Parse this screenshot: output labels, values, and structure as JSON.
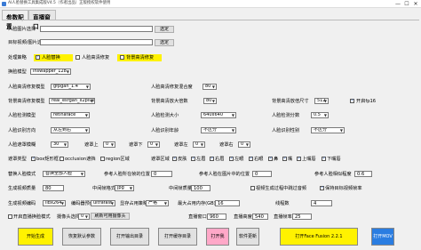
{
  "window": {
    "title": "AI人脸替换工具集成版V4.5（作者出品）正版授权软件使用",
    "min": "—",
    "max": "☐",
    "close": "✕"
  },
  "tabs": [
    "参数配置",
    "直播窗口"
  ],
  "face_image": {
    "label": "人脸图片选择",
    "value": "",
    "button": "选定"
  },
  "target": {
    "label": "目标视频/图片选择",
    "value": "",
    "button": "选定"
  },
  "strategy": {
    "label": "处理策略",
    "options": [
      {
        "label": "人脸替换",
        "checked": true
      },
      {
        "label": "人脸高清修复",
        "checked": false
      },
      {
        "label": "背景高清修复",
        "checked": false
      }
    ]
  },
  "swap_model": {
    "label": "换脸模型",
    "value": "inswapper_128"
  },
  "face_enhance_model": {
    "label": "人脸高清修复模型",
    "value": "gfpgan_1.4"
  },
  "face_enhance_blend": {
    "label": "人脸高清修复混合度",
    "value": "80"
  },
  "bg_enhance_model": {
    "label": "背景高清修复模型",
    "value": "real_esrgan_x2plus"
  },
  "bg_enhance_scale": {
    "label": "背景高清放大倍数",
    "value": "80"
  },
  "bg_enhance_size": {
    "label": "背景高清放倍尺寸",
    "value": "512"
  },
  "fp16": {
    "label": "开启fp16",
    "checked": true
  },
  "face_detect_model": {
    "label": "人脸检测模型",
    "value": "retinaface"
  },
  "face_detect_size": {
    "label": "人脸检测大小",
    "value": "640x640"
  },
  "face_detect_score": {
    "label": "人脸检测分数",
    "value": "0.5"
  },
  "face_detect_order": {
    "label": "人脸识别方向",
    "value": "从左到右"
  },
  "face_age": {
    "label": "人脸识别年龄",
    "value": "不区分"
  },
  "face_gender": {
    "label": "人脸识别性别",
    "value": "不区分"
  },
  "face_blur": {
    "label": "人脸遮罩模糊",
    "value": "30"
  },
  "mask_top": {
    "label": "遮罩上",
    "value": "0"
  },
  "mask_bottom": {
    "label": "遮罩下",
    "value": "0"
  },
  "mask_left": {
    "label": "遮罩左",
    "value": "0"
  },
  "mask_right": {
    "label": "遮罩右",
    "value": "0"
  },
  "mask_types": {
    "label": "遮罩类型",
    "options": [
      {
        "label": "box矩形框",
        "checked": true
      },
      {
        "label": "occlusion遮挡",
        "checked": false
      },
      {
        "label": "region区域",
        "checked": false
      }
    ]
  },
  "mask_regions": {
    "label": "遮罩区域",
    "options": [
      {
        "label": "皮肤",
        "checked": true
      },
      {
        "label": "左眉",
        "checked": true
      },
      {
        "label": "右眉",
        "checked": true
      },
      {
        "label": "左眼",
        "checked": true
      },
      {
        "label": "右眼",
        "checked": true
      },
      {
        "label": "鼻",
        "checked": true
      },
      {
        "label": "嘴",
        "checked": true
      },
      {
        "label": "上嘴唇",
        "checked": true
      },
      {
        "label": "下嘴唇",
        "checked": true
      }
    ]
  },
  "swap_mode": {
    "label": "替换人脸模式",
    "value": "替换全部人脸"
  },
  "ref_position": {
    "label": "参考人脸所在帧的位置",
    "value": "0"
  },
  "ref_face_index": {
    "label": "参考人脸在图片中的位置",
    "value": "0"
  },
  "ref_similarity": {
    "label": "参考人脸相似程度",
    "value": "0.6"
  },
  "video_quality": {
    "label": "生成视频质量",
    "value": "80"
  },
  "frame_format": {
    "label": "中间帧格式",
    "value": "jpg"
  },
  "frame_quality": {
    "label": "中间帧质量",
    "value": "100"
  },
  "skip_audio": {
    "label": "视频生成过程中跳过音频",
    "checked": false
  },
  "keep_fps": {
    "label": "保持目标视频帧率",
    "checked": true
  },
  "encoder": {
    "label": "生成视频编码",
    "value": "libx264"
  },
  "encoder_preset": {
    "label": "编码器预设",
    "value": "ultrafast"
  },
  "memory_strategy": {
    "label": "显存占用策略",
    "value": "严格"
  },
  "max_memory": {
    "label": "最大占用内存(GB)",
    "value": "16"
  },
  "threads": {
    "label": "线程数",
    "value": "4"
  },
  "live_mode": {
    "label": "开启直播换脸模式",
    "checked": false
  },
  "camera_index": {
    "label": "摄像头选择",
    "value": "0"
  },
  "detect_camera": {
    "label": "刷新可用摄像头"
  },
  "live_window": {
    "label": "直播窗口",
    "label_w": "直播窗口",
    "width": "960",
    "label_h": "直播高度",
    "height": "540"
  },
  "live_fps": {
    "label": "直播帧率",
    "value": "25"
  },
  "buttons": {
    "start": "开始生成",
    "restore": "恢复默认参数",
    "open_output": "打开输出目录",
    "open_cache": "打开缓存目录",
    "open_dir": "打开我",
    "update": "软件更新",
    "open_ff": "打开Face Fusion 2.2.1",
    "open_mov": "打开MOV"
  },
  "colors": {
    "start_bg": "#fff200",
    "open_ff_bg": "#fff200",
    "open_dir_bg": "#ffa8c8",
    "open_mov_bg": "#2a7de1"
  }
}
